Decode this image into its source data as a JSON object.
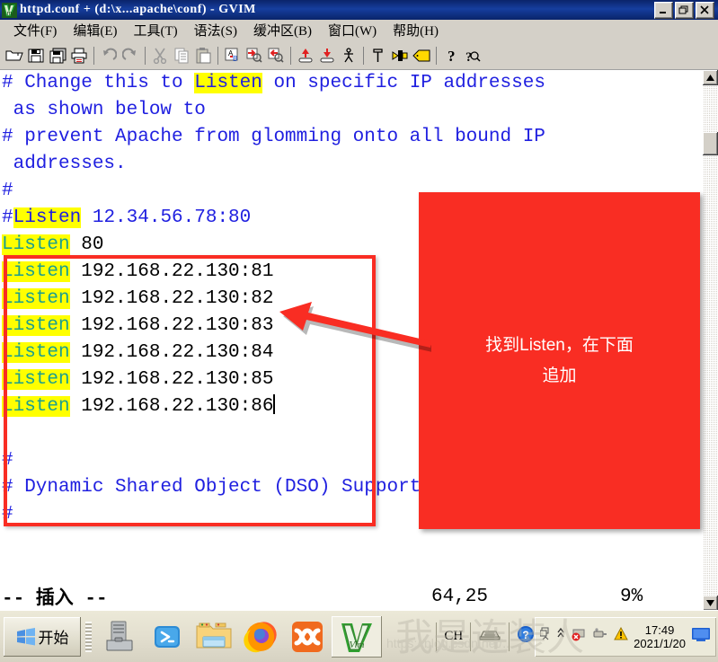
{
  "window": {
    "title": "httpd.conf + (d:\\x...apache\\conf) - GVIM",
    "icon": "gvim-icon",
    "buttons": [
      {
        "name": "minimize-button",
        "glyph": "_"
      },
      {
        "name": "maximize-button",
        "glyph": "❐"
      },
      {
        "name": "close-button",
        "glyph": "✕"
      }
    ]
  },
  "menubar": {
    "items": [
      {
        "name": "menu-file",
        "label": "文件(F)"
      },
      {
        "name": "menu-edit",
        "label": "编辑(E)"
      },
      {
        "name": "menu-tools",
        "label": "工具(T)"
      },
      {
        "name": "menu-syntax",
        "label": "语法(S)"
      },
      {
        "name": "menu-buffers",
        "label": "缓冲区(B)"
      },
      {
        "name": "menu-window",
        "label": "窗口(W)"
      },
      {
        "name": "menu-help",
        "label": "帮助(H)"
      }
    ]
  },
  "toolbar": {
    "items": [
      "open-icon",
      "save-icon",
      "save-all-icon",
      "print-icon",
      "sep",
      "undo-icon",
      "redo-icon",
      "sep",
      "cut-icon",
      "copy-icon",
      "paste-icon",
      "sep",
      "find-icon",
      "find-next-icon",
      "find-prev-icon",
      "sep",
      "load-session-icon",
      "save-session-icon",
      "run-script-icon",
      "sep",
      "make-icon",
      "shell-icon",
      "tag-icon",
      "sep",
      "help-icon",
      "find-help-icon"
    ]
  },
  "editor": {
    "lines": [
      {
        "id": "line-1",
        "spans": [
          {
            "text": "# Change this to ",
            "style": "comment"
          },
          {
            "text": "Listen",
            "style": "comment-hl"
          },
          {
            "text": " on specific IP addresses",
            "style": "comment"
          }
        ]
      },
      {
        "id": "line-2",
        "spans": [
          {
            "text": " as shown below to",
            "style": "comment"
          }
        ]
      },
      {
        "id": "line-3",
        "spans": [
          {
            "text": "# prevent Apache from glomming onto all bound IP",
            "style": "comment"
          }
        ]
      },
      {
        "id": "line-4",
        "spans": [
          {
            "text": " addresses.",
            "style": "comment"
          }
        ]
      },
      {
        "id": "line-5",
        "spans": [
          {
            "text": "#",
            "style": "comment"
          }
        ]
      },
      {
        "id": "line-6",
        "spans": [
          {
            "text": "#",
            "style": "comment"
          },
          {
            "text": "Listen",
            "style": "comment-hl"
          },
          {
            "text": " 12.34.56.78:80",
            "style": "comment"
          }
        ]
      },
      {
        "id": "line-7",
        "spans": [
          {
            "text": "Listen",
            "style": "keyword-hl"
          },
          {
            "text": " 80",
            "style": "plain"
          }
        ]
      },
      {
        "id": "line-8",
        "spans": [
          {
            "text": "Listen",
            "style": "keyword-hl"
          },
          {
            "text": " 192.168.22.130:81",
            "style": "plain"
          }
        ]
      },
      {
        "id": "line-9",
        "spans": [
          {
            "text": "Listen",
            "style": "keyword-hl"
          },
          {
            "text": " 192.168.22.130:82",
            "style": "plain"
          }
        ]
      },
      {
        "id": "line-10",
        "spans": [
          {
            "text": "Listen",
            "style": "keyword-hl"
          },
          {
            "text": " 192.168.22.130:83",
            "style": "plain"
          }
        ]
      },
      {
        "id": "line-11",
        "spans": [
          {
            "text": "Listen",
            "style": "keyword-hl"
          },
          {
            "text": " 192.168.22.130:84",
            "style": "plain"
          }
        ]
      },
      {
        "id": "line-12",
        "spans": [
          {
            "text": "Listen",
            "style": "keyword-hl"
          },
          {
            "text": " 192.168.22.130:85",
            "style": "plain"
          }
        ]
      },
      {
        "id": "line-13",
        "spans": [
          {
            "text": "Listen",
            "style": "keyword-hl"
          },
          {
            "text": " 192.168.22.130:86",
            "style": "plain"
          },
          {
            "text": "",
            "style": "cursor"
          }
        ]
      },
      {
        "id": "line-14",
        "spans": []
      },
      {
        "id": "line-15",
        "spans": [
          {
            "text": "#",
            "style": "comment"
          }
        ]
      },
      {
        "id": "line-16",
        "spans": [
          {
            "text": "# Dynamic Shared Object (DSO) Support",
            "style": "comment"
          }
        ]
      },
      {
        "id": "line-17",
        "spans": [
          {
            "text": "#",
            "style": "comment"
          }
        ]
      }
    ],
    "colors": {
      "comment": "#2020e0",
      "keyword": "#1a9e8f",
      "highlight": "#ffff00",
      "plain": "#000000",
      "background": "#ffffff"
    }
  },
  "statusline": {
    "mode": "-- 插入 --",
    "position": "64,25",
    "percent": "9%"
  },
  "scrollbar": {
    "up_arrow": "scroll-up-icon",
    "down_arrow": "scroll-down-icon",
    "thumb": "scroll-thumb"
  },
  "annotation": {
    "box_color": "#f92d23",
    "text_line1": "找到Listen，在下面",
    "text_line2": "追加",
    "arrow": "left-arrow"
  },
  "taskbar": {
    "start_label": "开始",
    "quick_launch": [
      {
        "name": "quicklaunch-server-toolbox-icon"
      },
      {
        "name": "quicklaunch-powershell-icon"
      },
      {
        "name": "quicklaunch-explorer-icon"
      },
      {
        "name": "quicklaunch-firefox-icon"
      },
      {
        "name": "quicklaunch-xampp-icon"
      }
    ],
    "tasks": [
      {
        "name": "taskbar-item-gvim",
        "icon": "gvim-icon"
      }
    ],
    "tray": {
      "input_indicator": "CH",
      "icons": [
        "keyboard-icon",
        "help-icon",
        "show-hidden-icon",
        "chevron-up-icon",
        "error-icon",
        "usb-icon",
        "warning-icon",
        "network-icon"
      ],
      "time": "17:49",
      "date": "2021/1/20"
    },
    "watermark": {
      "big": "我是连装人",
      "url": "https://blog.csdn.net/..."
    }
  }
}
